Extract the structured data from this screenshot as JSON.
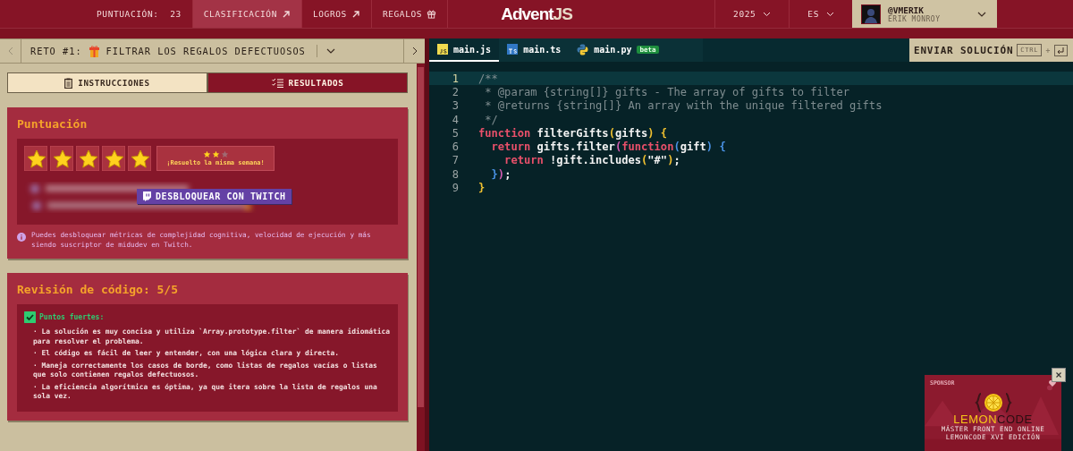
{
  "nav": {
    "score_label": "PUNTUACIÓN:",
    "score": "23",
    "links": [
      {
        "label": "CLASIFICACIÓN",
        "kind": "external",
        "selected": true
      },
      {
        "label": "LOGROS",
        "kind": "external",
        "selected": false
      },
      {
        "label": "REGALOS",
        "kind": "gift",
        "selected": false
      }
    ],
    "logo": {
      "part_1": "Advent",
      "part_2": "JS"
    },
    "year": "2025",
    "language": "ES",
    "user": {
      "handle": "@VMERIK",
      "name": "ERIK MONROY"
    }
  },
  "challenge": {
    "label": "RETO #1:",
    "title": "FILTRAR LOS REGALOS DEFECTUOSOS"
  },
  "panel_tabs": [
    {
      "label": "INSTRUCCIONES",
      "kind": "instructions",
      "selected": false
    },
    {
      "label": "RESULTADOS",
      "kind": "results",
      "selected": true
    }
  ],
  "score_card": {
    "title": "Puntuación",
    "stars": 5,
    "bonus": {
      "stars": 2,
      "label": "¡Resuelto la misma semana!"
    },
    "unlock_button": "DESBLOQUEAR CON TWITCH",
    "note": "Puedes desbloquear métricas de complejidad cognitiva, velocidad de ejecución y más siendo suscriptor de midudev en Twitch."
  },
  "review_card": {
    "title": "Revisión de código: 5/5",
    "section": {
      "title": "Puntos fuertes:",
      "checked": true,
      "items": [
        "· La solución es muy concisa y utiliza `Array.prototype.filter` de manera idiomática para resolver el problema.",
        "· El código es fácil de leer y entender, con una lógica clara y directa.",
        "· Maneja correctamente los casos de borde, como listas de regalos vacías o listas que solo contienen regalos defectuosos.",
        "· La eficiencia algorítmica es óptima, ya que itera sobre la lista de regalos una sola vez."
      ]
    }
  },
  "editor": {
    "files": [
      {
        "name": "main.js",
        "kind": "js",
        "selected": true
      },
      {
        "name": "main.ts",
        "kind": "ts",
        "selected": false
      },
      {
        "name": "main.py",
        "kind": "py",
        "selected": false,
        "badge": "beta"
      }
    ],
    "submit": {
      "label": "ENVIAR SOLUCIÓN",
      "modifier": "CTRL",
      "joiner": "+"
    },
    "lines": [
      {
        "number": "1",
        "active": true,
        "tokens": [
          {
            "kind": "comment",
            "text": "/**"
          }
        ]
      },
      {
        "number": "2",
        "active": false,
        "tokens": [
          {
            "kind": "comment",
            "text": " * @param {string[]} gifts - The array of gifts to filter"
          }
        ]
      },
      {
        "number": "3",
        "active": false,
        "tokens": [
          {
            "kind": "comment",
            "text": " * @returns {string[]} An array with the unique filtered gifts"
          }
        ]
      },
      {
        "number": "4",
        "active": false,
        "tokens": [
          {
            "kind": "comment",
            "text": " */"
          }
        ]
      },
      {
        "number": "5",
        "active": false,
        "tokens": [
          {
            "kind": "keyword",
            "text": "function"
          },
          {
            "kind": "plain",
            "text": " filterGifts"
          },
          {
            "kind": "bracket1",
            "text": "("
          },
          {
            "kind": "plain",
            "text": "gifts"
          },
          {
            "kind": "bracket1",
            "text": ")"
          },
          {
            "kind": "bracket1",
            "text": " {"
          }
        ]
      },
      {
        "number": "6",
        "active": false,
        "tokens": [
          {
            "kind": "keyword",
            "text": "  return"
          },
          {
            "kind": "plain",
            "text": " gifts.filter"
          },
          {
            "kind": "bracket2",
            "text": "("
          },
          {
            "kind": "keyword",
            "text": "function"
          },
          {
            "kind": "bracket3",
            "text": "("
          },
          {
            "kind": "plain",
            "text": "gift"
          },
          {
            "kind": "bracket3",
            "text": ")"
          },
          {
            "kind": "bracket3",
            "text": " {"
          }
        ]
      },
      {
        "number": "7",
        "active": false,
        "tokens": [
          {
            "kind": "keyword",
            "text": "    return"
          },
          {
            "kind": "plain",
            "text": " !gift.includes"
          },
          {
            "kind": "bracket1",
            "text": "("
          },
          {
            "kind": "string",
            "text": "\"#\""
          },
          {
            "kind": "bracket1",
            "text": ")"
          },
          {
            "kind": "plain",
            "text": ";"
          }
        ]
      },
      {
        "number": "8",
        "active": false,
        "tokens": [
          {
            "kind": "bracket3",
            "text": "  }"
          },
          {
            "kind": "bracket2",
            "text": ")"
          },
          {
            "kind": "plain",
            "text": ";"
          }
        ]
      },
      {
        "number": "9",
        "active": false,
        "tokens": [
          {
            "kind": "bracket1",
            "text": "}"
          }
        ]
      }
    ]
  },
  "sponsor": {
    "label": "SPONSOR",
    "brand": {
      "part_1": "LEMON",
      "part_2": "CODE"
    },
    "lines": [
      "MÁSTER FRONT END ONLINE",
      "LEMONCODE XVI EDICIÓN"
    ]
  }
}
